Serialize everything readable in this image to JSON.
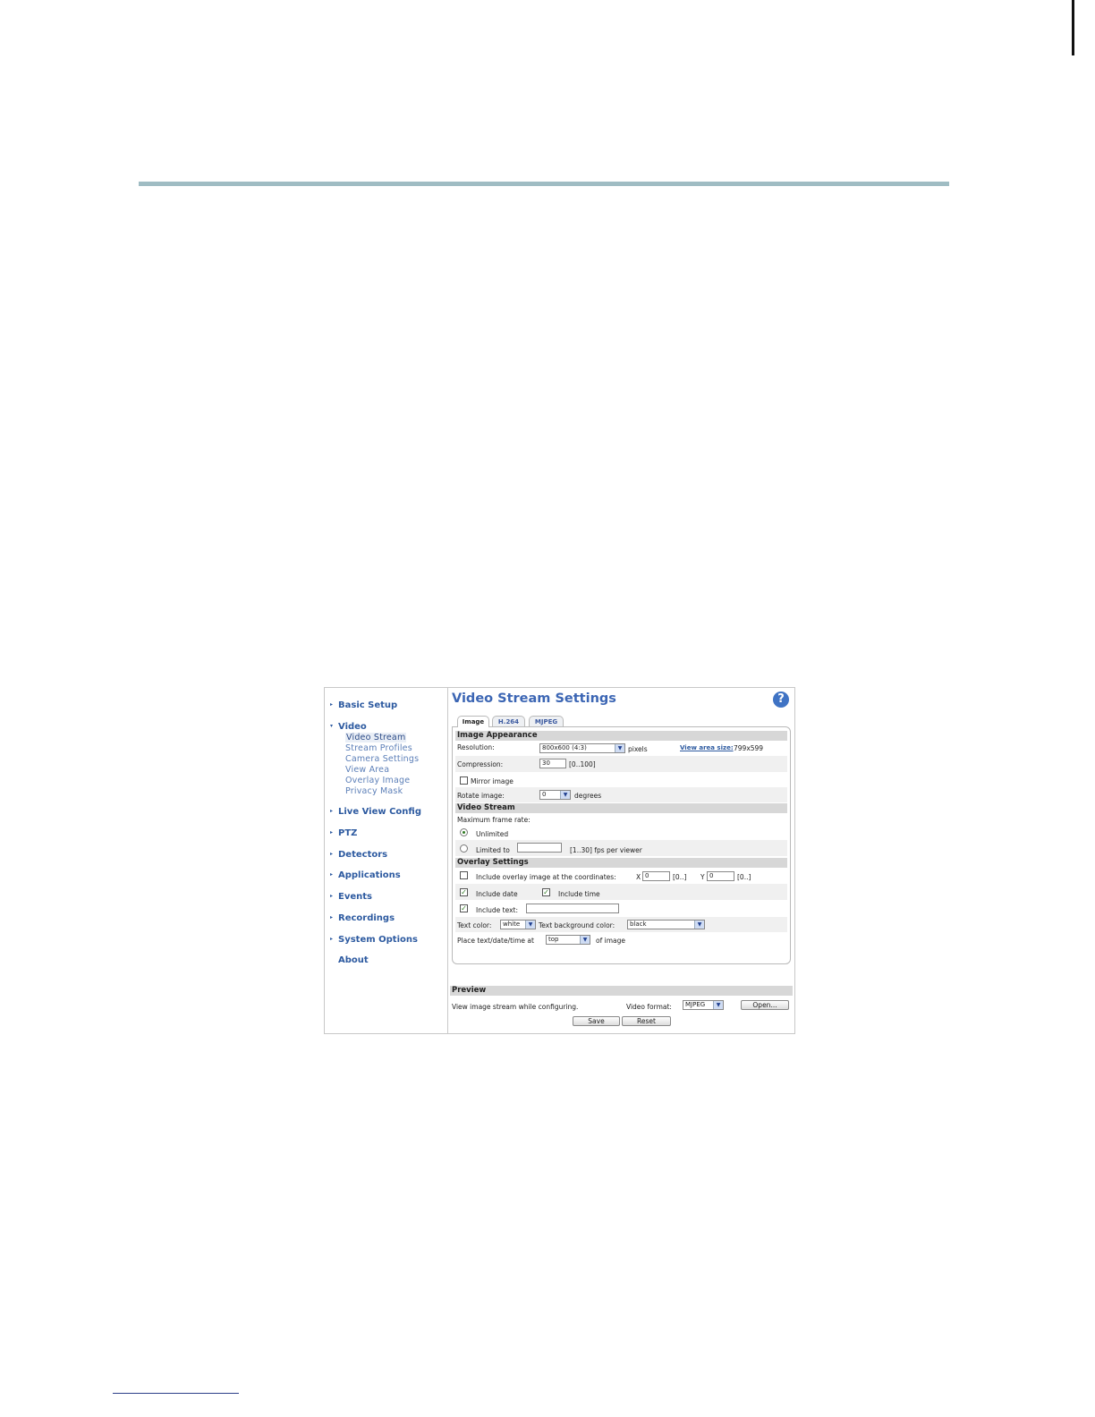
{
  "sidebar": {
    "items": [
      {
        "label": "Basic Setup",
        "arrow": "▸"
      },
      {
        "label": "Video",
        "arrow": "▾",
        "sub": [
          "Video Stream",
          "Stream Profiles",
          "Camera Settings",
          "View Area",
          "Overlay Image",
          "Privacy Mask"
        ],
        "selected": "Video Stream"
      },
      {
        "label": "Live View Config",
        "arrow": "▸"
      },
      {
        "label": "PTZ",
        "arrow": "▸"
      },
      {
        "label": "Detectors",
        "arrow": "▸"
      },
      {
        "label": "Applications",
        "arrow": "▸"
      },
      {
        "label": "Events",
        "arrow": "▸"
      },
      {
        "label": "Recordings",
        "arrow": "▸"
      },
      {
        "label": "System Options",
        "arrow": "▸"
      },
      {
        "label": "About",
        "arrow": ""
      }
    ]
  },
  "header": {
    "title": "Video Stream Settings",
    "help": "?"
  },
  "tabs": [
    {
      "label": "Image",
      "active": true
    },
    {
      "label": "H.264",
      "active": false
    },
    {
      "label": "MJPEG",
      "active": false
    }
  ],
  "image_appearance": {
    "heading": "Image Appearance",
    "resolution_label": "Resolution:",
    "resolution_value": "800x600 (4:3)",
    "pixels": "pixels",
    "view_area_link": "View area size:",
    "view_area_value": "799x599",
    "compression_label": "Compression:",
    "compression_value": "30",
    "compression_range": "[0..100]",
    "mirror_label": "Mirror image",
    "rotate_label": "Rotate image:",
    "rotate_value": "0",
    "degrees": "degrees"
  },
  "video_stream": {
    "heading": "Video Stream",
    "max_frame_rate": "Maximum frame rate:",
    "unlimited": "Unlimited",
    "limited_to": "Limited to",
    "fps_range": "[1..30] fps per viewer"
  },
  "overlay": {
    "heading": "Overlay Settings",
    "include_overlay": "Include overlay image at the coordinates:",
    "x_label": "X",
    "x_value": "0",
    "x_range": "[0..]",
    "y_label": "Y",
    "y_value": "0",
    "y_range": "[0..]",
    "include_date": "Include date",
    "include_time": "Include time",
    "include_text": "Include text:",
    "text_color_label": "Text color:",
    "text_color_value": "white",
    "text_bg_label": "Text background color:",
    "text_bg_value": "black",
    "place_label": "Place text/date/time at",
    "place_value": "top",
    "of_image": "of image",
    "check_mark": "✓"
  },
  "preview": {
    "heading": "Preview",
    "desc": "View image stream while configuring.",
    "format_label": "Video format:",
    "format_value": "MJPEG",
    "open_button": "Open...",
    "dropdown_glyph": "▼"
  },
  "actions": {
    "save": "Save",
    "reset": "Reset"
  },
  "colors": {
    "accent": "#3c66b4",
    "rule": "#9fbcc3"
  }
}
